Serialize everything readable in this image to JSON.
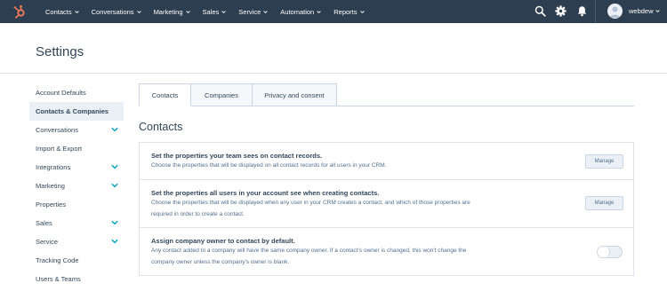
{
  "colors": {
    "nav_bg": "#2d3e50",
    "brand_orange": "#ff7a59",
    "teal_chevron": "#00a4bd",
    "active_bg": "#eaf0f6"
  },
  "nav": {
    "logo": "hubspot-sprocket-icon",
    "menu": [
      {
        "label": "Contacts"
      },
      {
        "label": "Conversations"
      },
      {
        "label": "Marketing"
      },
      {
        "label": "Sales"
      },
      {
        "label": "Service"
      },
      {
        "label": "Automation"
      },
      {
        "label": "Reports"
      }
    ],
    "icons": [
      "search-icon",
      "gear-icon",
      "bell-icon"
    ],
    "username": "webdew"
  },
  "header": {
    "title": "Settings"
  },
  "sidebar": {
    "items": [
      {
        "label": "Account Defaults",
        "expandable": false
      },
      {
        "label": "Contacts & Companies",
        "expandable": false,
        "active": true
      },
      {
        "label": "Conversations",
        "expandable": true
      },
      {
        "label": "Import & Export",
        "expandable": false
      },
      {
        "label": "Integrations",
        "expandable": true
      },
      {
        "label": "Marketing",
        "expandable": true
      },
      {
        "label": "Properties",
        "expandable": false
      },
      {
        "label": "Sales",
        "expandable": true
      },
      {
        "label": "Service",
        "expandable": true
      },
      {
        "label": "Tracking Code",
        "expandable": false
      },
      {
        "label": "Users & Teams",
        "expandable": false
      }
    ]
  },
  "tabs": [
    {
      "label": "Contacts",
      "active": true
    },
    {
      "label": "Companies",
      "active": false
    },
    {
      "label": "Privacy and consent",
      "active": false
    }
  ],
  "section": {
    "title": "Contacts",
    "rows": [
      {
        "title": "Set the properties your team sees on contact records.",
        "desc_lines": [
          "Choose the properties that will be displayed on all contact records for all users in your CRM."
        ],
        "button": "Manage"
      },
      {
        "title": "Set the properties all users in your account see when creating contacts.",
        "desc_lines": [
          "Choose the properties that will be displayed when any user in your CRM creates a contact, and which of those properties are",
          "required in order to create a contact."
        ],
        "button": "Manage"
      },
      {
        "title": "Assign company owner to contact by default.",
        "desc_lines": [
          "Any contact added to a company will have the same company owner. If a contact's owner is changed, this won't change the",
          "company owner unless the company's owner is blank."
        ],
        "toggle_on": false
      }
    ]
  }
}
